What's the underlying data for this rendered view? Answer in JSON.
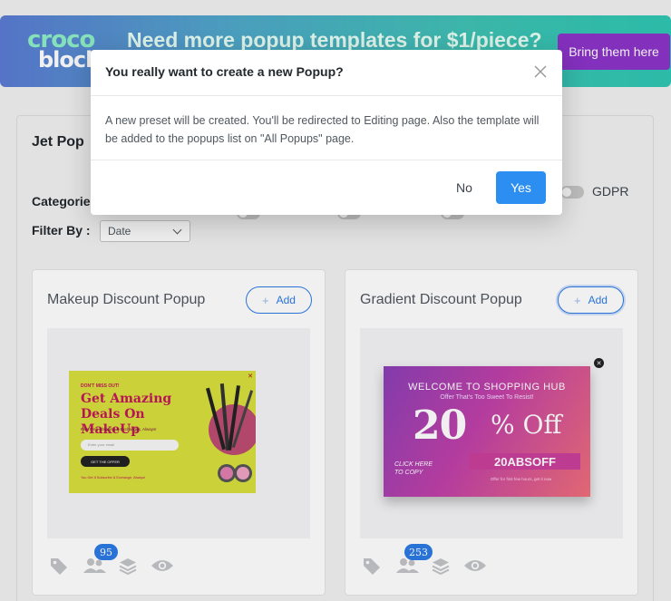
{
  "banner": {
    "logo_line1": "croco",
    "logo_line2": "block",
    "title": "Need more popup templates for $1/piece?",
    "button": "Bring them here"
  },
  "panel": {
    "title": "Jet Pop",
    "categories_label": "Categorie",
    "gdpr_label": "GDPR",
    "filter_label": "Filter By :",
    "filter_value": "Date"
  },
  "cards": [
    {
      "title": "Makeup Discount Popup",
      "add_label": "Add",
      "badge_count": "95",
      "preview": {
        "kicker": "DON'T MISS OUT!",
        "headline": "Get Amazing Deals On MakeUp",
        "subline": "Plus Free Shipping & Exchanges, Always!",
        "email_placeholder": "Enter your email",
        "cta": "GET THE OFFER",
        "fine_print": "You Get It Subscribe & Exchange, Always!"
      }
    },
    {
      "title": "Gradient Discount Popup",
      "add_label": "Add",
      "badge_count": "253",
      "preview": {
        "headline": "WELCOME TO SHOPPING HUB",
        "subline": "Offer That's Too Sweet To Resist!",
        "big_number": "20",
        "big_suffix": "% Off",
        "code": "20ABSOFF",
        "click_text": "CLICK HERE TO COPY",
        "fine_print": "Offer for first few hours, get it now"
      }
    }
  ],
  "modal": {
    "title": "You really want to create a new Popup?",
    "body": "A new preset will be created. You'll be redirected to Editing page. Also the template will be added to the popups list on \"All Popups\" page.",
    "no_label": "No",
    "yes_label": "Yes"
  },
  "colors": {
    "accent": "#2c8ef0",
    "banner_button": "#8c34c9"
  },
  "icons": [
    "tag-icon",
    "users-icon",
    "layers-icon",
    "eye-icon",
    "close-icon",
    "chevron-down-icon"
  ]
}
